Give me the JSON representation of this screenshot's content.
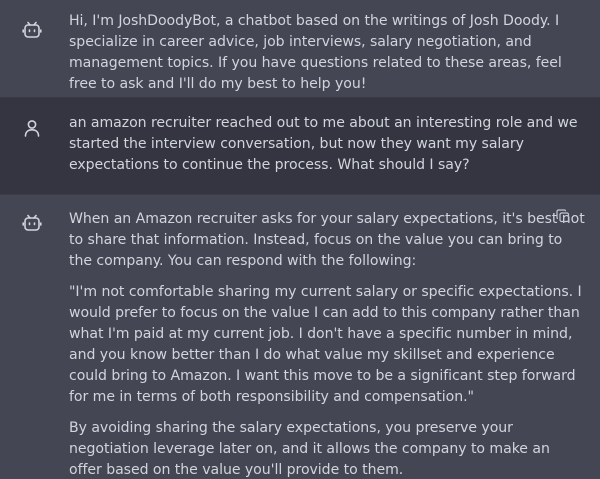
{
  "conversation": {
    "messages": [
      {
        "role": "bot",
        "avatar_icon": "bot-icon",
        "paragraphs": [
          "Hi, I'm JoshDoodyBot, a chatbot based on the writings of Josh Doody. I specialize in career advice, job interviews, salary negotiation, and management topics. If you have questions related to these areas, feel free to ask and I'll do my best to help you!"
        ]
      },
      {
        "role": "user",
        "avatar_icon": "user-icon",
        "paragraphs": [
          "an amazon recruiter reached out to me about an interesting role and we started the interview conversation, but now they want my salary expectations to continue the process. What should I say?"
        ]
      },
      {
        "role": "bot",
        "avatar_icon": "bot-icon",
        "action_icon": "copy-icon",
        "paragraphs": [
          "When an Amazon recruiter asks for your salary expectations, it's best not to share that information. Instead, focus on the value you can bring to the company. You can respond with the following:",
          "\"I'm not comfortable sharing my current salary or specific expectations. I would prefer to focus on the value I can add to this company rather than what I'm paid at my current job. I don't have a specific number in mind, and you know better than I do what value my skillset and experience could bring to Amazon. I want this move to be a significant step forward for me in terms of both responsibility and compensation.\"",
          "By avoiding sharing the salary expectations, you preserve your negotiation leverage later on, and it allows the company to make an offer based on the value you'll provide to them."
        ]
      }
    ]
  },
  "colors": {
    "bot_background": "#444654",
    "user_background": "#343541",
    "text": "#d1d5db",
    "icon": "#d1d5db"
  }
}
